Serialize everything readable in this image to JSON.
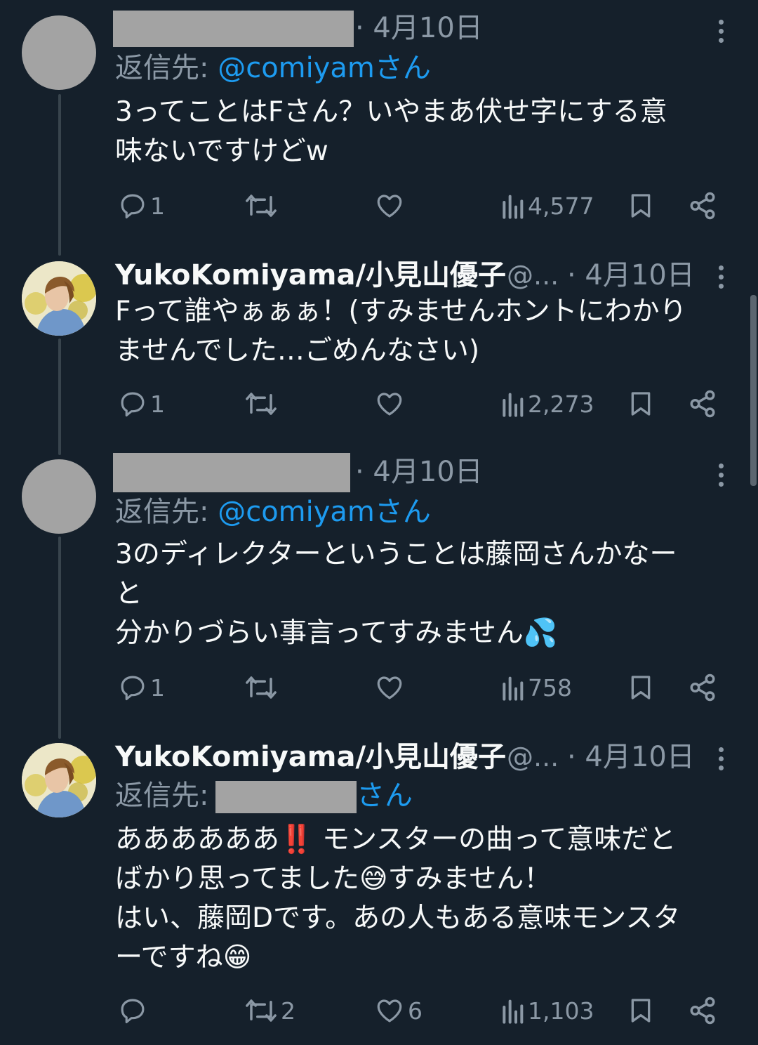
{
  "tweets": [
    {
      "author_name": "",
      "author_handle": "",
      "date": "· 4月10日",
      "reply_label": "返信先:",
      "reply_mention": "@comiyam",
      "reply_suffix": "さん",
      "text": "3ってことはFさん？いやまあ伏せ字にする意\n味ないですけどw",
      "replies": "1",
      "retweets": "",
      "likes": "",
      "views": "4,577"
    },
    {
      "author_name": "YukoKomiyama/小見山優子",
      "author_handle": "@...",
      "date": "· 4月10日",
      "text": "Fって誰やぁぁぁ！(すみませんホントにわかり\nませんでした…ごめんなさい)",
      "replies": "1",
      "retweets": "",
      "likes": "",
      "views": "2,273"
    },
    {
      "author_name": "",
      "author_handle": "",
      "date": "· 4月10日",
      "reply_label": "返信先:",
      "reply_mention": "@comiyam",
      "reply_suffix": "さん",
      "text": "3のディレクターということは藤岡さんかなー\nと\n分かりづらい事言ってすみません💦",
      "replies": "1",
      "retweets": "",
      "likes": "",
      "views": "758"
    },
    {
      "author_name": "YukoKomiyama/小見山優子",
      "author_handle": "@...",
      "date": "· 4月10日",
      "reply_label": "返信先:",
      "reply_suffix": "さん",
      "text": "ああああああ‼️ モンスターの曲って意味だと\nばかり思ってました😅すみません！\nはい、藤岡Dです。あの人もある意味モンスタ\nーですね😁",
      "replies": "",
      "retweets": "2",
      "likes": "6",
      "views": "1,103"
    }
  ],
  "colors": {
    "background": "#15202b",
    "text": "#f7f9f9",
    "muted": "#8b98a5",
    "link": "#1d9bf0",
    "redaction": "#a3a3a3"
  },
  "icons": [
    "reply-icon",
    "retweet-icon",
    "like-icon",
    "views-icon",
    "bookmark-icon",
    "share-icon",
    "more-icon"
  ]
}
